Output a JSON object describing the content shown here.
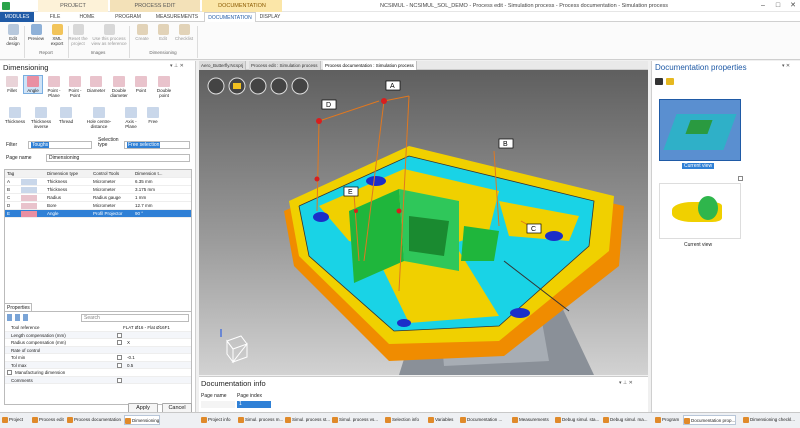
{
  "titlebar": {
    "context_tabs": [
      "PROJECT",
      "PROCESS EDIT",
      "DOCUMENTATION"
    ],
    "title": "NCSIMUL - NCSIMUL_SOL_DEMO - Process edit - Simulation process - Process documentation - Simulation process"
  },
  "tabs": [
    "MODULES",
    "FILE",
    "HOME",
    "PROGRAM",
    "MEASUREMENTS",
    "DOCUMENTATION",
    "DISPLAY"
  ],
  "ribbon": {
    "buttons": [
      {
        "label": "Edit design",
        "icon": "edit-design-icon"
      },
      {
        "label": "Preview",
        "icon": "preview-icon"
      },
      {
        "label": "XML export",
        "icon": "xml-export-icon"
      },
      {
        "label": "Reset the project",
        "icon": "reset-icon"
      },
      {
        "label": "Use this process view as reference",
        "icon": "reference-view-icon"
      },
      {
        "label": "Create",
        "icon": "create-icon"
      },
      {
        "label": "Edit",
        "icon": "edit-icon"
      },
      {
        "label": "Checklist",
        "icon": "checklist-icon"
      }
    ],
    "groups": [
      "Report",
      "Images",
      "Dimensioning"
    ]
  },
  "dimensioning": {
    "title": "Dimensioning",
    "tools": [
      "Fillet",
      "Angle",
      "Point - Plane",
      "Point - Point",
      "Diameter",
      "Double diameter",
      "Point",
      "Double point",
      "Thickness",
      "Thickness inverse",
      "Thread",
      "Hole centre-distance",
      "Axis - Plane",
      "Free"
    ],
    "filter_label": "Filter",
    "filter_value": "Toughs",
    "selection_label": "Selection type",
    "selection_value": "Free selection",
    "page_name_label": "Page name",
    "page_name_value": "Dimensioning",
    "columns": [
      "Tag",
      "",
      "Dimension type",
      "Control Tools",
      "Dimension t..."
    ],
    "rows": [
      {
        "tag": "A",
        "type": "Thickness",
        "tool": "Micrometer",
        "value": "6.35 mm"
      },
      {
        "tag": "B",
        "type": "Thickness",
        "tool": "Micrometer",
        "value": "3.175 mm"
      },
      {
        "tag": "C",
        "type": "Radius",
        "tool": "Radius gauge",
        "value": "1 mm"
      },
      {
        "tag": "D",
        "type": "Bore",
        "tool": "Micrometer",
        "value": "12.7 mm"
      },
      {
        "tag": "E",
        "type": "Angle",
        "tool": "Profil Projector",
        "value": "90 °"
      }
    ]
  },
  "properties": {
    "tab": "Properties",
    "search_placeholder": "Search",
    "rows": [
      {
        "label": "Tool reference",
        "value": "FLAT Ø16 - Flat Ø16F1",
        "check": false
      },
      {
        "label": "Length compensation (mm)",
        "value": "",
        "check": true
      },
      {
        "label": "Radius compensation (mm)",
        "value": "X",
        "check": true
      },
      {
        "label": "Rate of control",
        "value": "",
        "check": false
      },
      {
        "label": "Tol min",
        "value": "-0.1",
        "check": true
      },
      {
        "label": "Tol max",
        "value": "0.5",
        "check": true
      },
      {
        "label": "Manufacturing dimension",
        "value": "",
        "check": true
      },
      {
        "label": "Comments",
        "value": "",
        "check": true
      }
    ],
    "apply": "Apply",
    "cancel": "Cancel"
  },
  "doc_tabs": [
    "Aero_Butterfly.Ncsprj",
    "Process edit : Simulation process",
    "Process documentation : Simulation process"
  ],
  "viewport_tags": [
    "A",
    "B",
    "C",
    "D",
    "E"
  ],
  "doc_info": {
    "title": "Documentation info",
    "col1": "Page name",
    "col2": "Page index",
    "page_index": "1"
  },
  "doc_properties": {
    "title": "Documentation properties",
    "view1": "Current view",
    "view2": "Current view"
  },
  "statusbar": [
    "Project",
    "Process edit",
    "Process documentation",
    "Dimensioning",
    "Project info",
    "Simul. process m...",
    "Simul. process st...",
    "Simul. process vs...",
    "Selection info",
    "Variables",
    "Documentation ...",
    "Measurements",
    "Debug simul. sta...",
    "Debug simul. ma...",
    "Program",
    "Documentation prop...",
    "Dimensioning checkl..."
  ],
  "colors": {
    "accent": "#1f5aa6",
    "part_yellow": "#f0d000",
    "part_cyan": "#19d3e6",
    "part_green": "#1fb63c",
    "part_orange": "#f08c00"
  }
}
